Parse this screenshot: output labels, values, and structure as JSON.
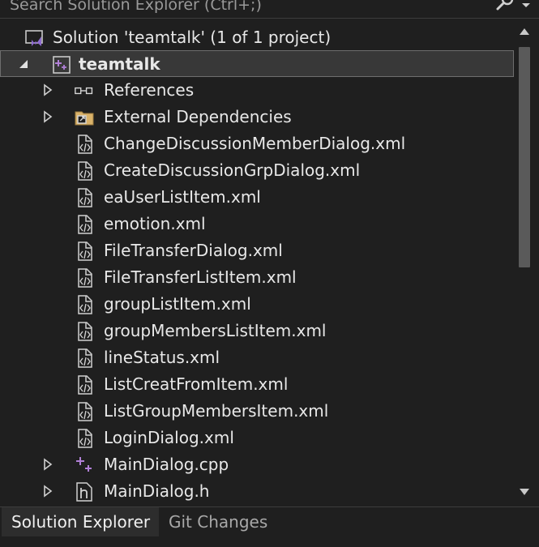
{
  "search": {
    "placeholder": "Search Solution Explorer (Ctrl+;)"
  },
  "tree": {
    "solution_label": "Solution 'teamtalk' (1 of 1 project)",
    "project_label": "teamtalk",
    "items": [
      {
        "label": "References",
        "icon": "references-icon",
        "expandable": true
      },
      {
        "label": "External Dependencies",
        "icon": "external-dependencies-folder-icon",
        "expandable": true
      },
      {
        "label": "ChangeDiscussionMemberDialog.xml",
        "icon": "xml-file-icon",
        "expandable": false
      },
      {
        "label": "CreateDiscussionGrpDialog.xml",
        "icon": "xml-file-icon",
        "expandable": false
      },
      {
        "label": "eaUserListItem.xml",
        "icon": "xml-file-icon",
        "expandable": false
      },
      {
        "label": "emotion.xml",
        "icon": "xml-file-icon",
        "expandable": false
      },
      {
        "label": "FileTransferDialog.xml",
        "icon": "xml-file-icon",
        "expandable": false
      },
      {
        "label": "FileTransferListItem.xml",
        "icon": "xml-file-icon",
        "expandable": false
      },
      {
        "label": "groupListItem.xml",
        "icon": "xml-file-icon",
        "expandable": false
      },
      {
        "label": "groupMembersListItem.xml",
        "icon": "xml-file-icon",
        "expandable": false
      },
      {
        "label": "lineStatus.xml",
        "icon": "xml-file-icon",
        "expandable": false
      },
      {
        "label": "ListCreatFromItem.xml",
        "icon": "xml-file-icon",
        "expandable": false
      },
      {
        "label": "ListGroupMembersItem.xml",
        "icon": "xml-file-icon",
        "expandable": false
      },
      {
        "label": "LoginDialog.xml",
        "icon": "xml-file-icon",
        "expandable": false
      },
      {
        "label": "MainDialog.cpp",
        "icon": "cpp-file-icon",
        "expandable": true
      },
      {
        "label": "MainDialog.h",
        "icon": "header-file-icon",
        "expandable": true
      }
    ]
  },
  "tabs": {
    "solution_explorer": "Solution Explorer",
    "git_changes": "Git Changes"
  },
  "colors": {
    "background": "#1f1f1f",
    "selection": "#383838",
    "text": "#e8e8e8",
    "project_icon_purple": "#b180d7"
  }
}
